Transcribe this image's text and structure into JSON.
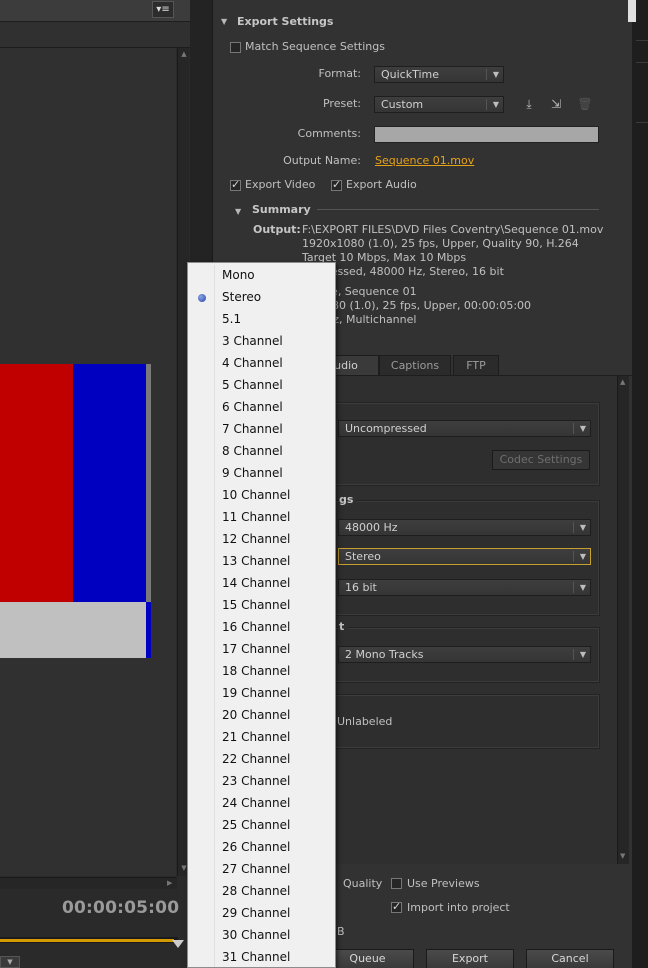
{
  "preview": {
    "timecode": "00:00:05:00",
    "colors": {
      "red": "#c00000",
      "blue": "#0000c0",
      "gray": "#c0c0c0",
      "timeline": "#d49a00"
    }
  },
  "export_settings": {
    "title": "Export Settings",
    "match_sequence_label": "Match Sequence Settings",
    "match_sequence_checked": false,
    "format_label": "Format:",
    "format_value": "QuickTime",
    "preset_label": "Preset:",
    "preset_value": "Custom",
    "comments_label": "Comments:",
    "comments_value": "",
    "output_name_label": "Output Name:",
    "output_name_value": "Sequence 01.mov",
    "export_video_label": "Export Video",
    "export_video_checked": true,
    "export_audio_label": "Export Audio",
    "export_audio_checked": true
  },
  "summary": {
    "title": "Summary",
    "output_label": "Output:",
    "output_lines": [
      "F:\\EXPORT FILES\\DVD Files Coventry\\Sequence 01.mov",
      "1920x1080 (1.0), 25 fps, Upper, Quality 90, H.264",
      "Target 10 Mbps, Max 10 Mbps",
      "ompressed, 48000 Hz, Stereo, 16 bit"
    ],
    "source_lines": [
      "ce, Sequence 01",
      "080 (1.0), 25 fps, Upper, 00:00:05:00",
      "Hz, Multichannel"
    ]
  },
  "tabs": [
    {
      "label": "udio",
      "active": true
    },
    {
      "label": "Captions",
      "active": false
    },
    {
      "label": "FTP",
      "active": false
    }
  ],
  "audio": {
    "codec_value": "Uncompressed",
    "codec_settings_label": "Codec Settings",
    "basic_settings_title": "gs",
    "sample_rate_value": "48000 Hz",
    "channels_value": "Stereo",
    "sample_size_value": "16 bit",
    "layout_title": "t",
    "layout_value": "2 Mono Tracks",
    "label_value": "Unlabeled"
  },
  "bottom": {
    "quality_label": "Quality",
    "use_previews_label": "Use Previews",
    "use_previews_checked": false,
    "import_label": "Import into project",
    "import_checked": true,
    "size_fragment": "B",
    "queue_label": "Queue",
    "export_label": "Export",
    "cancel_label": "Cancel"
  },
  "channel_menu": {
    "selected": "Stereo",
    "items": [
      "Mono",
      "Stereo",
      "5.1",
      "3 Channel",
      "4 Channel",
      "5 Channel",
      "6 Channel",
      "7 Channel",
      "8 Channel",
      "9 Channel",
      "10 Channel",
      "11 Channel",
      "12 Channel",
      "13 Channel",
      "14 Channel",
      "15 Channel",
      "16 Channel",
      "17 Channel",
      "18 Channel",
      "19 Channel",
      "20 Channel",
      "21 Channel",
      "22 Channel",
      "23 Channel",
      "24 Channel",
      "25 Channel",
      "26 Channel",
      "27 Channel",
      "28 Channel",
      "29 Channel",
      "30 Channel",
      "31 Channel"
    ]
  },
  "icons": {
    "panel_menu": "panel-menu-icon",
    "save_preset": "save-preset-icon",
    "import_preset": "import-preset-icon",
    "delete_preset": "trash-icon",
    "radio": "radio-selected-icon"
  }
}
